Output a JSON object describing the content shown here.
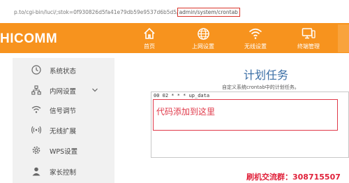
{
  "browser": {
    "url_prefix": "p.to/cgi-bin/luci/;stok=0f930826d5fa41e79db59e9537d6b5d5/",
    "url_highlight": "admin/system/crontab"
  },
  "header": {
    "logo": "HICOMM",
    "nav": [
      {
        "label": "首页",
        "icon": "home-icon"
      },
      {
        "label": "上网设置",
        "icon": "globe-icon"
      },
      {
        "label": "无线设置",
        "icon": "wifi-icon"
      },
      {
        "label": "终端管理",
        "icon": "monitor-icon"
      }
    ]
  },
  "sidebar": {
    "items": [
      {
        "label": "系统状态",
        "icon": "clock-icon"
      },
      {
        "label": "内网设置",
        "icon": "network-icon",
        "expandable": true
      },
      {
        "label": "信号调节",
        "icon": "signal-icon"
      },
      {
        "label": "无线扩展",
        "icon": "wireless-extend-icon"
      },
      {
        "label": "WPS设置",
        "icon": "gear-icon"
      },
      {
        "label": "家长控制",
        "icon": "user-icon"
      }
    ]
  },
  "main": {
    "title": "计划任务",
    "subtitle": "自定义系统crontab中的计划任务。",
    "editor_content": "00 02 * * * up_data",
    "annotation": "代码添加到这里"
  },
  "watermark": "刷机交流群：308715507",
  "colors": {
    "header_bg": "#f7931e",
    "title": "#3a6ea5",
    "annotation": "#e0394a",
    "watermark": "#e0213a"
  }
}
